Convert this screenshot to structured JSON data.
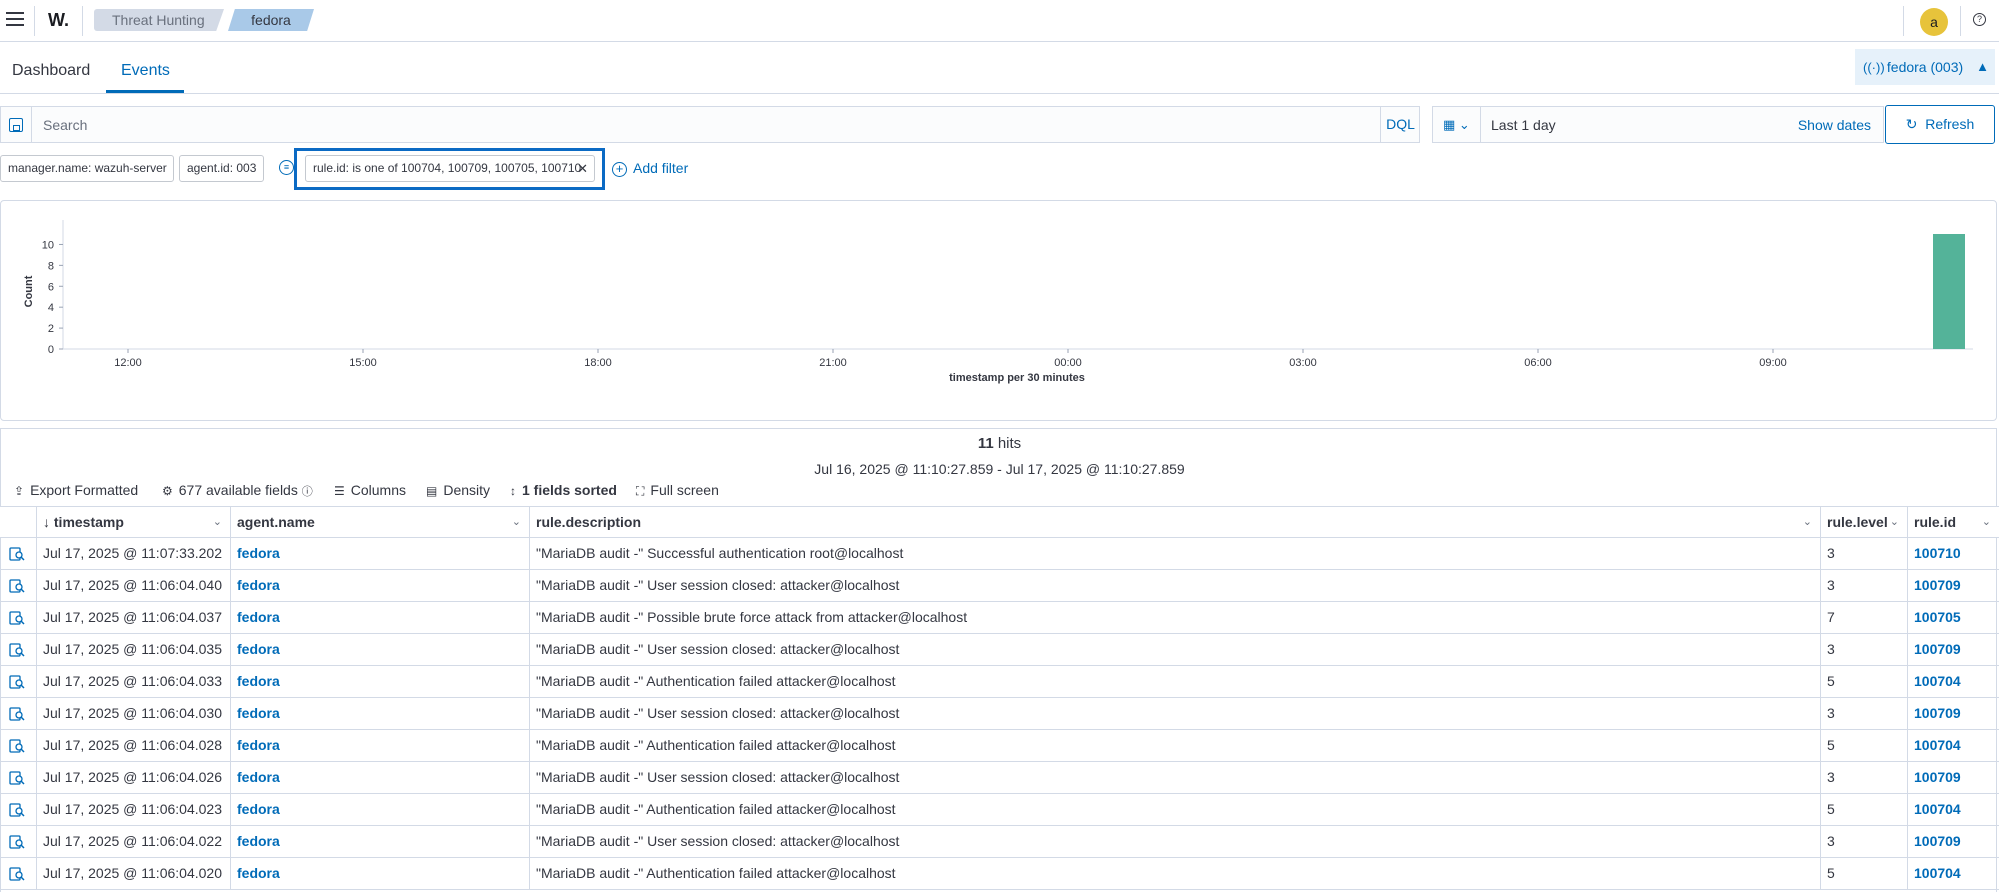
{
  "header": {
    "logo": "W.",
    "breadcrumbs": [
      "Threat Hunting",
      "fedora"
    ],
    "avatar_initial": "a",
    "help_glyph": "?"
  },
  "tabs": [
    {
      "label": "Dashboard",
      "active": false
    },
    {
      "label": "Events",
      "active": true
    }
  ],
  "agent_pill": {
    "label": "fedora (003)",
    "icon": "signal-icon",
    "pin_icon": "pin-icon"
  },
  "search": {
    "placeholder": "Search",
    "language": "DQL"
  },
  "date_picker": {
    "value": "Last 1 day",
    "show_dates": "Show dates",
    "refresh": "Refresh"
  },
  "filters": [
    {
      "label": "manager.name: wazuh-server"
    },
    {
      "label": "agent.id: 003"
    },
    {
      "label": "rule.id: is one of 100704, 100709, 100705, 100710",
      "highlighted": true
    }
  ],
  "add_filter": "Add filter",
  "chart_data": {
    "type": "bar",
    "ylabel": "Count",
    "xlabel": "timestamp per 30 minutes",
    "yticks": [
      "0",
      "2",
      "4",
      "6",
      "8",
      "10"
    ],
    "xticks": [
      "12:00",
      "15:00",
      "18:00",
      "21:00",
      "00:00",
      "03:00",
      "06:00",
      "09:00"
    ],
    "ylim": [
      0,
      11
    ],
    "categories": [
      "11:00"
    ],
    "values": [
      11
    ],
    "color": "#54b399",
    "grid": false
  },
  "results": {
    "hits_count": "11",
    "hits_label": "hits",
    "range": "Jul 16, 2025 @ 11:10:27.859 - Jul 17, 2025 @ 11:10:27.859",
    "toolbar": {
      "export": "Export Formatted",
      "fields": "677 available fields",
      "columns": "Columns",
      "density": "Density",
      "sorted": "1 fields sorted",
      "fullscreen": "Full screen"
    },
    "columns": [
      "timestamp",
      "agent.name",
      "rule.description",
      "rule.level",
      "rule.id"
    ],
    "rows": [
      {
        "timestamp": "Jul 17, 2025 @ 11:07:33.202",
        "agent": "fedora",
        "description": "\"MariaDB audit -\" Successful authentication root@localhost",
        "level": "3",
        "rule_id": "100710"
      },
      {
        "timestamp": "Jul 17, 2025 @ 11:06:04.040",
        "agent": "fedora",
        "description": "\"MariaDB audit -\" User session closed: attacker@localhost",
        "level": "3",
        "rule_id": "100709"
      },
      {
        "timestamp": "Jul 17, 2025 @ 11:06:04.037",
        "agent": "fedora",
        "description": "\"MariaDB audit -\" Possible brute force attack from attacker@localhost",
        "level": "7",
        "rule_id": "100705"
      },
      {
        "timestamp": "Jul 17, 2025 @ 11:06:04.035",
        "agent": "fedora",
        "description": "\"MariaDB audit -\" User session closed: attacker@localhost",
        "level": "3",
        "rule_id": "100709"
      },
      {
        "timestamp": "Jul 17, 2025 @ 11:06:04.033",
        "agent": "fedora",
        "description": "\"MariaDB audit -\" Authentication failed attacker@localhost",
        "level": "5",
        "rule_id": "100704"
      },
      {
        "timestamp": "Jul 17, 2025 @ 11:06:04.030",
        "agent": "fedora",
        "description": "\"MariaDB audit -\" User session closed: attacker@localhost",
        "level": "3",
        "rule_id": "100709"
      },
      {
        "timestamp": "Jul 17, 2025 @ 11:06:04.028",
        "agent": "fedora",
        "description": "\"MariaDB audit -\" Authentication failed attacker@localhost",
        "level": "5",
        "rule_id": "100704"
      },
      {
        "timestamp": "Jul 17, 2025 @ 11:06:04.026",
        "agent": "fedora",
        "description": "\"MariaDB audit -\" User session closed: attacker@localhost",
        "level": "3",
        "rule_id": "100709"
      },
      {
        "timestamp": "Jul 17, 2025 @ 11:06:04.023",
        "agent": "fedora",
        "description": "\"MariaDB audit -\" Authentication failed attacker@localhost",
        "level": "5",
        "rule_id": "100704"
      },
      {
        "timestamp": "Jul 17, 2025 @ 11:06:04.022",
        "agent": "fedora",
        "description": "\"MariaDB audit -\" User session closed: attacker@localhost",
        "level": "3",
        "rule_id": "100709"
      },
      {
        "timestamp": "Jul 17, 2025 @ 11:06:04.020",
        "agent": "fedora",
        "description": "\"MariaDB audit -\" Authentication failed attacker@localhost",
        "level": "5",
        "rule_id": "100704"
      }
    ]
  }
}
